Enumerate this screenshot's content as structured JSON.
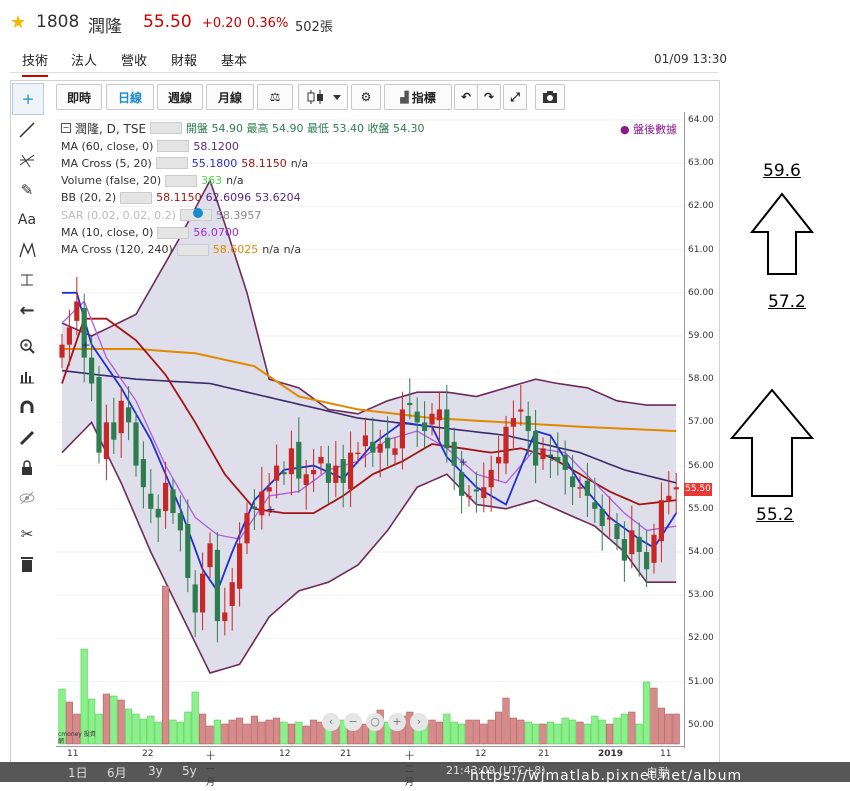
{
  "stock": {
    "code": "1808",
    "name": "潤隆",
    "price": "55.50",
    "change": "+0.20",
    "change_pct": "0.36%",
    "volume": "502張"
  },
  "nav_tabs": [
    "技術",
    "法人",
    "營收",
    "財報",
    "基本"
  ],
  "datetime": "01/09 13:30",
  "toolbar": {
    "intraday": "即時",
    "daily": "日線",
    "weekly": "週線",
    "monthly": "月線",
    "indicator": "指標"
  },
  "legend": {
    "title": "潤隆, D, TSE",
    "ohlc": "開盤 54.90 最高 54.90 最低 53.40 收盤 54.30",
    "after_hours": "盤後數據",
    "rows": [
      {
        "label": "MA (60, close, 0)",
        "values": [
          "58.1200"
        ],
        "colors": [
          "#5a2a82"
        ]
      },
      {
        "label": "MA Cross (5, 20)",
        "values": [
          "55.1800",
          "58.1150",
          "n/a"
        ],
        "colors": [
          "#1f2fd6",
          "#a31515",
          "#333333"
        ]
      },
      {
        "label": "Volume (false, 20)",
        "values": [
          "363",
          "n/a"
        ],
        "colors": [
          "#4dd94d",
          "#333333"
        ]
      },
      {
        "label": "BB (20, 2)",
        "values": [
          "58.1150",
          "62.6096",
          "53.6204"
        ],
        "colors": [
          "#a31515",
          "#5a2a82",
          "#5a2a82"
        ]
      },
      {
        "label": "SAR (0.02, 0.02, 0.2)",
        "values": [
          "58.3957"
        ],
        "colors": [
          "#888888"
        ]
      },
      {
        "label": "MA (10, close, 0)",
        "values": [
          "56.0700"
        ],
        "colors": [
          "#9b30d6"
        ]
      },
      {
        "label": "MA Cross (120, 240)",
        "values": [
          "58.6025",
          "n/a",
          "n/a"
        ],
        "colors": [
          "#e08a00",
          "#333333",
          "#333333"
        ]
      }
    ]
  },
  "y_axis": [
    "64.00",
    "63.00",
    "62.00",
    "61.00",
    "60.00",
    "59.00",
    "58.00",
    "57.00",
    "56.00",
    "55.00",
    "54.00",
    "53.00",
    "52.00",
    "51.00",
    "50.00"
  ],
  "price_tag": "55.50",
  "x_axis": [
    "11",
    "22",
    "十一月",
    "12",
    "21",
    "十二月",
    "12",
    "21",
    "2019",
    "11"
  ],
  "bottom": {
    "ranges": [
      "1日",
      "6月",
      "3y",
      "5y"
    ],
    "time": "21:43:09 (UTC+8)",
    "mode": "自動",
    "logo_text": "cmoney 投資網",
    "watermark": "https://wjmatlab.pixnet.net/album"
  },
  "annotations": [
    "59.6",
    "57.2",
    "55.2"
  ],
  "colors": {
    "up": "#c62828",
    "down": "#2e7d4f",
    "bb_fill": "#d9d9e8",
    "bb_band": "#6e2a5a",
    "ma60": "#3b2a6b",
    "ma5": "#1f2fd6",
    "ma20": "#a31515",
    "ma10": "#b05ce0",
    "ma120": "#e08a00"
  }
}
